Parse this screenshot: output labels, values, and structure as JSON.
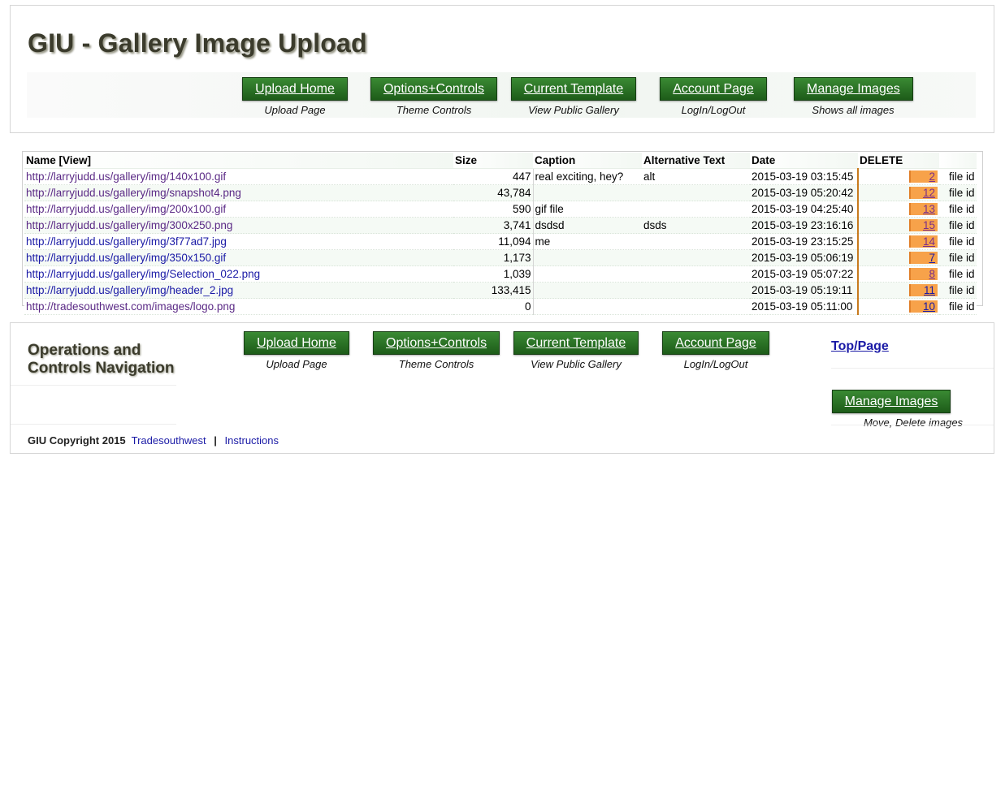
{
  "header": {
    "title": "GIU - Gallery Image Upload"
  },
  "nav": [
    {
      "label": "Upload Home",
      "sub": "Upload Page"
    },
    {
      "label": "Options+Controls",
      "sub": "Theme Controls"
    },
    {
      "label": "Current Template",
      "sub": "View Public Gallery"
    },
    {
      "label": "Account Page",
      "sub": "LogIn/LogOut"
    },
    {
      "label": "Manage Images",
      "sub": "Shows all images"
    }
  ],
  "table": {
    "headers": [
      "Name [View]",
      "Size",
      "Caption",
      "Alternative Text",
      "Date",
      "DELETE"
    ],
    "rows": [
      {
        "name": "http://larryjudd.us/gallery/img/140x100.gif",
        "size": "447",
        "caption": "real exciting, hey?",
        "alt": "alt",
        "date": "2015-03-19 03:15:45",
        "del": "2",
        "fileid": "file id"
      },
      {
        "name": "http://larryjudd.us/gallery/img/snapshot4.png",
        "size": "43,784",
        "caption": "",
        "alt": "",
        "date": "2015-03-19 05:20:42",
        "del": "12",
        "fileid": "file id"
      },
      {
        "name": "http://larryjudd.us/gallery/img/200x100.gif",
        "size": "590",
        "caption": "gif file",
        "alt": "",
        "date": "2015-03-19 04:25:40",
        "del": "13",
        "fileid": "file id"
      },
      {
        "name": "http://larryjudd.us/gallery/img/300x250.png",
        "size": "3,741",
        "caption": "dsdsd",
        "alt": "dsds",
        "date": "2015-03-19 23:16:16",
        "del": "15",
        "fileid": "file id"
      },
      {
        "name": "http://larryjudd.us/gallery/img/3f77ad7.jpg",
        "size": "11,094",
        "caption": "me",
        "alt": "",
        "date": "2015-03-19 23:15:25",
        "del": "14",
        "fileid": "file id"
      },
      {
        "name": "http://larryjudd.us/gallery/img/350x150.gif",
        "size": "1,173",
        "caption": "",
        "alt": "",
        "date": "2015-03-19 05:06:19",
        "del": "7",
        "fileid": "file id"
      },
      {
        "name": "http://larryjudd.us/gallery/img/Selection_022.png",
        "size": "1,039",
        "caption": "",
        "alt": "",
        "date": "2015-03-19 05:07:22",
        "del": "8",
        "fileid": "file id"
      },
      {
        "name": "http://larryjudd.us/gallery/img/header_2.jpg",
        "size": "133,415",
        "caption": "",
        "alt": "",
        "date": "2015-03-19 05:19:11",
        "del": "11",
        "fileid": "file id"
      },
      {
        "name": "http://tradesouthwest.com/images/logo.png",
        "size": "0",
        "caption": "",
        "alt": "",
        "date": "2015-03-19 05:11:00",
        "del": "10",
        "fileid": "file id"
      }
    ]
  },
  "footer": {
    "ops_title_line1": "Operations and",
    "ops_title_line2": "Controls Navigation",
    "nav": [
      {
        "label": "Upload Home",
        "sub": "Upload Page"
      },
      {
        "label": "Options+Controls",
        "sub": "Theme Controls"
      },
      {
        "label": "Current Template",
        "sub": "View Public Gallery"
      },
      {
        "label": "Account Page",
        "sub": "LogIn/LogOut"
      }
    ],
    "top_link": "Top/Page",
    "manage": {
      "label": "Manage Images",
      "sub": "Move, Delete images"
    },
    "copyright": "GIU Copyright 2015",
    "link1": "Tradesouthwest",
    "separator": "|",
    "link2": "Instructions"
  },
  "colors": {
    "button_green": "#2a7326",
    "delete_orange": "#f7a24a",
    "link_blue": "#1a1aa6",
    "visited_purple": "#5b2a86"
  }
}
